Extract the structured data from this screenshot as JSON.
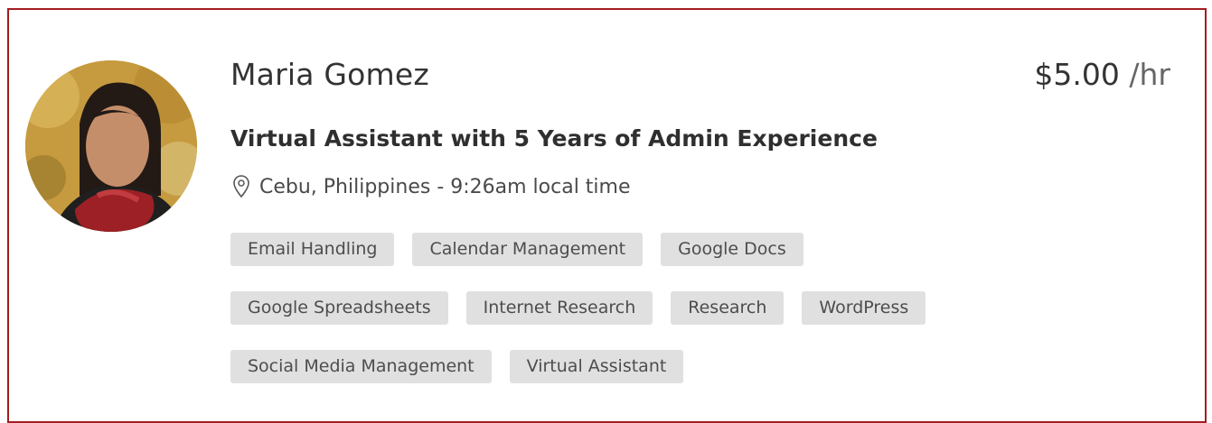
{
  "freelancer": {
    "name": "Maria Gomez",
    "rate": "$5.00",
    "rate_unit": "/hr",
    "headline": "Virtual Assistant with 5 Years of Admin Experience",
    "location_text": "Cebu, Philippines - 9:26am local time",
    "avatar_icon": "profile-photo",
    "location_icon": "map-pin-icon"
  },
  "skills": [
    [
      "Email Handling",
      "Calendar Management",
      "Google Docs"
    ],
    [
      "Google Spreadsheets",
      "Internet Research",
      "Research",
      "WordPress"
    ],
    [
      "Social Media Management",
      "Virtual Assistant"
    ]
  ],
  "colors": {
    "border": "#a31d22",
    "tag_bg": "#e0e0e0",
    "text": "#333333"
  }
}
